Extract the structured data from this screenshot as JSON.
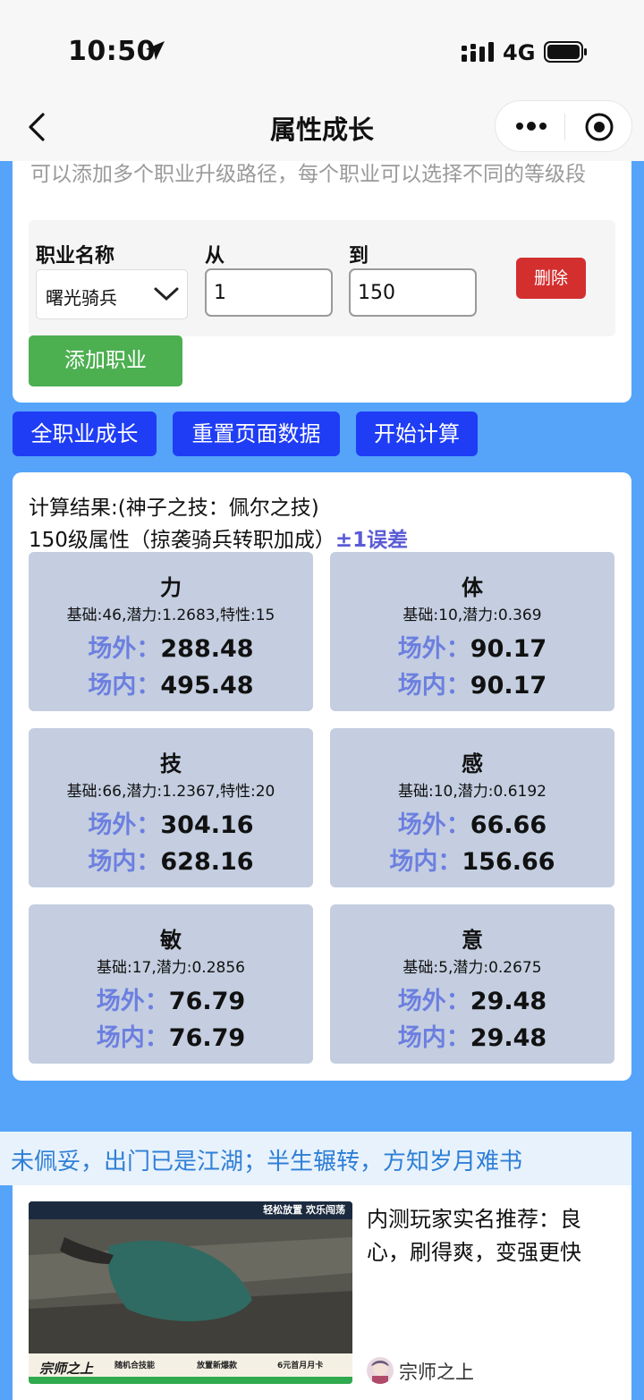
{
  "status": {
    "time": "10:50",
    "network": "4G"
  },
  "nav": {
    "title": "属性成长",
    "back_icon": "chevron-left-icon",
    "more_icon": "more-dots-icon",
    "close_icon": "target-icon"
  },
  "config": {
    "hint": "可以添加多个职业升级路径，每个职业可以选择不同的等级段",
    "job_label": "职业名称",
    "from_label": "从",
    "to_label": "到",
    "job_value": "曙光骑兵",
    "from_value": "1",
    "to_value": "150",
    "delete_label": "删除",
    "add_label": "添加职业"
  },
  "actions": {
    "all_growth": "全职业成长",
    "reset": "重置页面数据",
    "calculate": "开始计算"
  },
  "result": {
    "title": "计算结果:(神子之技：佩尔之技)",
    "subtitle": "150级属性（掠袭骑兵转职加成）",
    "error_note": "±1误差",
    "outside_label": "场外：",
    "inside_label": "场内：",
    "stats": [
      {
        "name": "力",
        "base": "基础:46,潜力:1.2683,特性:15",
        "outside": "288.48",
        "inside": "495.48"
      },
      {
        "name": "体",
        "base": "基础:10,潜力:0.369",
        "outside": "90.17",
        "inside": "90.17"
      },
      {
        "name": "技",
        "base": "基础:66,潜力:1.2367,特性:20",
        "outside": "304.16",
        "inside": "628.16"
      },
      {
        "name": "感",
        "base": "基础:10,潜力:0.6192",
        "outside": "66.66",
        "inside": "156.66"
      },
      {
        "name": "敏",
        "base": "基础:17,潜力:0.2856",
        "outside": "76.79",
        "inside": "76.79"
      },
      {
        "name": "意",
        "base": "基础:5,潜力:0.2675",
        "outside": "29.48",
        "inside": "29.48"
      }
    ]
  },
  "marquee": {
    "text": "未佩妥，出门已是江湖；半生辗转，方知岁月难书"
  },
  "ad": {
    "title": "内测玩家实名推荐：良心，刷得爽，变强更快",
    "source": "宗师之上",
    "banner_top": "轻松放置 欢乐闯荡",
    "banner_logo": "宗师之上",
    "badges": [
      "随机合技能",
      "放置新爆款",
      "6元首月月卡"
    ]
  }
}
